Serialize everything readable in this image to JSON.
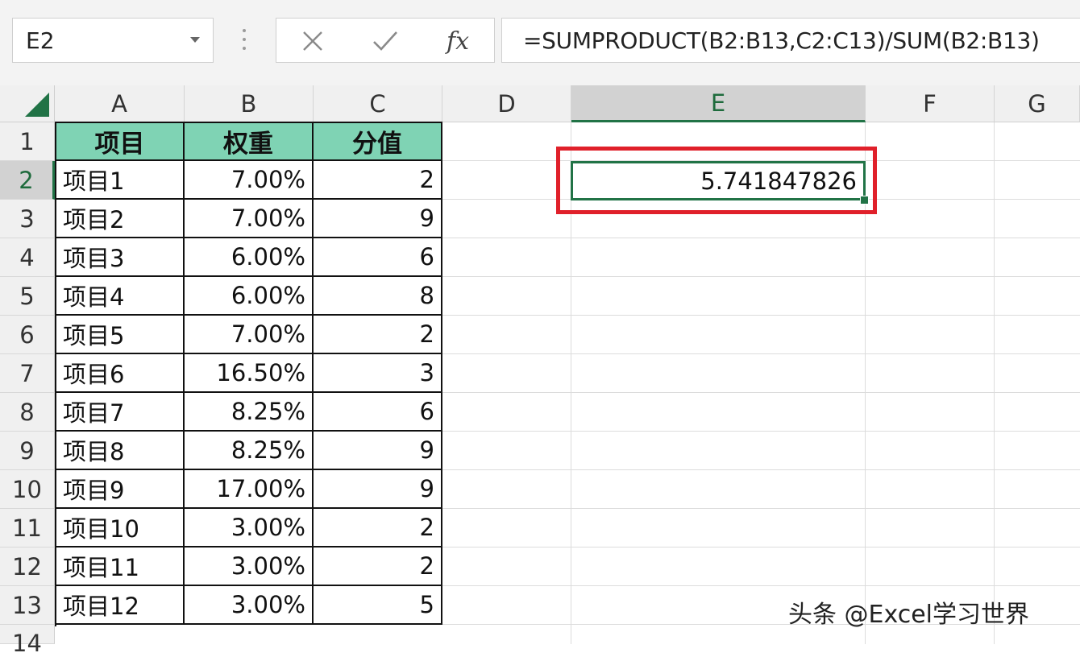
{
  "formula_bar": {
    "name_box": "E2",
    "cancel_icon": "close-icon",
    "enter_icon": "check-icon",
    "function_icon": "fx",
    "formula": "=SUMPRODUCT(B2:B13,C2:C13)/SUM(B2:B13)"
  },
  "columns": [
    "A",
    "B",
    "C",
    "D",
    "E",
    "F",
    "G"
  ],
  "selected_column": "E",
  "rows": [
    "1",
    "2",
    "3",
    "4",
    "5",
    "6",
    "7",
    "8",
    "9",
    "10",
    "11",
    "12",
    "13",
    "14"
  ],
  "selected_row": "2",
  "table": {
    "headers": [
      "项目",
      "权重",
      "分值"
    ],
    "data": [
      [
        "项目1",
        "7.00%",
        "2"
      ],
      [
        "项目2",
        "7.00%",
        "9"
      ],
      [
        "项目3",
        "6.00%",
        "6"
      ],
      [
        "项目4",
        "6.00%",
        "8"
      ],
      [
        "项目5",
        "7.00%",
        "2"
      ],
      [
        "项目6",
        "16.50%",
        "3"
      ],
      [
        "项目7",
        "8.25%",
        "6"
      ],
      [
        "项目8",
        "8.25%",
        "9"
      ],
      [
        "项目9",
        "17.00%",
        "9"
      ],
      [
        "项目10",
        "3.00%",
        "2"
      ],
      [
        "项目11",
        "3.00%",
        "2"
      ],
      [
        "项目12",
        "3.00%",
        "5"
      ]
    ]
  },
  "result_cell": {
    "address": "E2",
    "value": "5.741847826"
  },
  "colors": {
    "header_fill": "#7fd3b4",
    "excel_green": "#217346",
    "highlight_red": "#e0202a"
  },
  "watermark": "头条 @Excel学习世界"
}
